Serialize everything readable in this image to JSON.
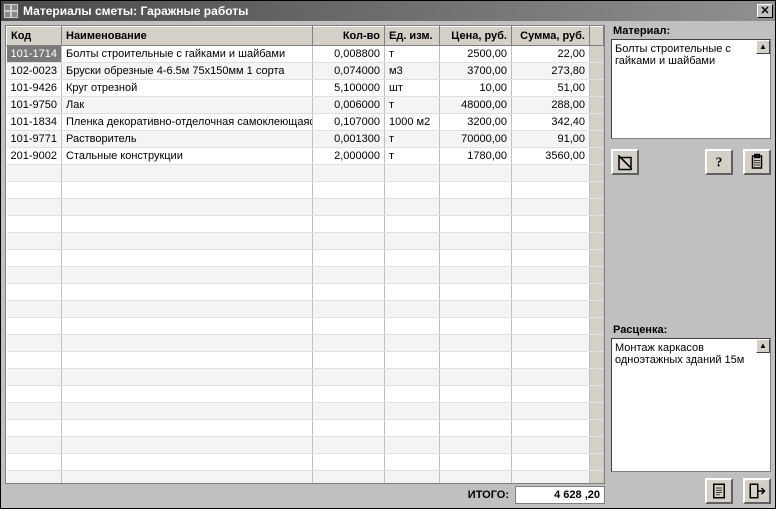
{
  "window": {
    "title": "Материалы сметы:  Гаражные работы"
  },
  "columns": {
    "code": "Код",
    "name": "Наименование",
    "qty": "Кол-во",
    "unit": "Ед. изм.",
    "price": "Цена, руб.",
    "sum": "Сумма, руб."
  },
  "rows": [
    {
      "code": "101-1714",
      "name": "Болты строительные с гайками и шайбами",
      "qty": "0,008800",
      "unit": "т",
      "price": "2500,00",
      "sum": "22,00",
      "selected": true
    },
    {
      "code": "102-0023",
      "name": "Бруски обрезные 4-6.5м 75х150мм 1 сорта",
      "qty": "0,074000",
      "unit": "м3",
      "price": "3700,00",
      "sum": "273,80"
    },
    {
      "code": "101-9426",
      "name": "Круг отрезной",
      "qty": "5,100000",
      "unit": "шт",
      "price": "10,00",
      "sum": "51,00"
    },
    {
      "code": "101-9750",
      "name": "Лак",
      "qty": "0,006000",
      "unit": "т",
      "price": "48000,00",
      "sum": "288,00"
    },
    {
      "code": "101-1834",
      "name": "Пленка декоративно-отделочная самоклеющаяся",
      "qty": "0,107000",
      "unit": "1000 м2",
      "price": "3200,00",
      "sum": "342,40"
    },
    {
      "code": "101-9771",
      "name": "Растворитель",
      "qty": "0,001300",
      "unit": "т",
      "price": "70000,00",
      "sum": "91,00"
    },
    {
      "code": "201-9002",
      "name": "Стальные конструкции",
      "qty": "2,000000",
      "unit": "т",
      "price": "1780,00",
      "sum": "3560,00"
    }
  ],
  "footer": {
    "label": "ИТОГО:",
    "value": "4 628 ,20"
  },
  "side": {
    "material_label": "Материал:",
    "material_text": "Болты строительные с гайками и шайбами",
    "rate_label": "Расценка:",
    "rate_text": "Монтаж каркасов одноэтажных зданий 15м"
  },
  "icons": {
    "delete": "delete-icon",
    "help": "help-icon",
    "clipboard": "clipboard-icon",
    "doc": "document-icon",
    "exit": "exit-icon"
  }
}
